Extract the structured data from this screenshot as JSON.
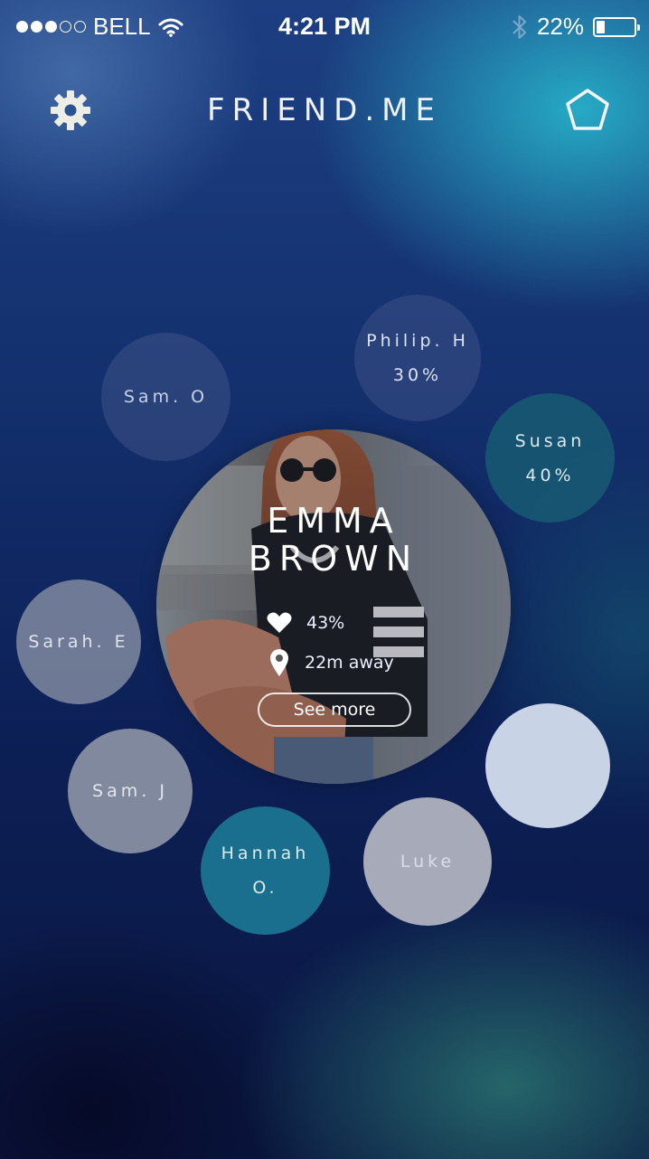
{
  "status_bar": {
    "signal_dots_full": 3,
    "signal_dots_total": 5,
    "carrier": "BELL",
    "time": "4:21 PM",
    "battery_percent": "22%",
    "battery_level": 0.22
  },
  "nav": {
    "title": "FRIEND.ME",
    "left_icon": "gear-icon",
    "right_icon": "pentagon-icon"
  },
  "profile": {
    "first_name": "EMMA",
    "last_name": "BROWN",
    "match": "43%",
    "distance": "22m away",
    "cta": "See more"
  },
  "friends": [
    {
      "line1": "Sam. O",
      "line2": ""
    },
    {
      "line1": "Philip. H",
      "line2": "30%"
    },
    {
      "line1": "Susan",
      "line2": "40%"
    },
    {
      "line1": "Sarah. E",
      "line2": ""
    },
    {
      "line1": "Sam. J",
      "line2": ""
    },
    {
      "line1": "Hannah",
      "line2": "O."
    },
    {
      "line1": "Luke",
      "line2": ""
    },
    {
      "line1": "",
      "line2": ""
    }
  ],
  "colors": {
    "accent_teal": "#1a6e8e",
    "bubble_light": "#c9d3e6"
  }
}
